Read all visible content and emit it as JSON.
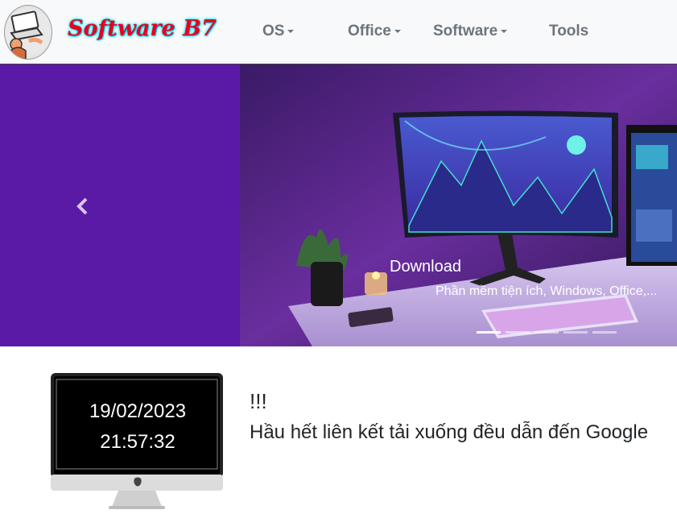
{
  "brand": {
    "name": "Software B7",
    "logo_icon": "laptop-user-icon"
  },
  "nav": {
    "items": [
      {
        "label": "OS",
        "dropdown": true
      },
      {
        "label": "Office",
        "dropdown": true
      },
      {
        "label": "Software",
        "dropdown": true
      },
      {
        "label": "Tools",
        "dropdown": false
      }
    ]
  },
  "carousel": {
    "caption_title": "Download",
    "caption_text": "Phần mềm tiện ích, Windows, Office,...",
    "slide_count": 5,
    "active_index": 0,
    "background_color": "#5a1aa6",
    "prev_icon": "chevron-left-icon"
  },
  "clock": {
    "date": "19/02/2023",
    "time": "21:57:32",
    "icon": "imac-icon"
  },
  "notice": {
    "title": "!!!",
    "text": "Hầu hết liên kết tải xuống đều dẫn đến Google"
  },
  "colors": {
    "brand_red": "#e8001c",
    "brand_glow": "#00e5ff",
    "nav_text": "#6c757d"
  }
}
